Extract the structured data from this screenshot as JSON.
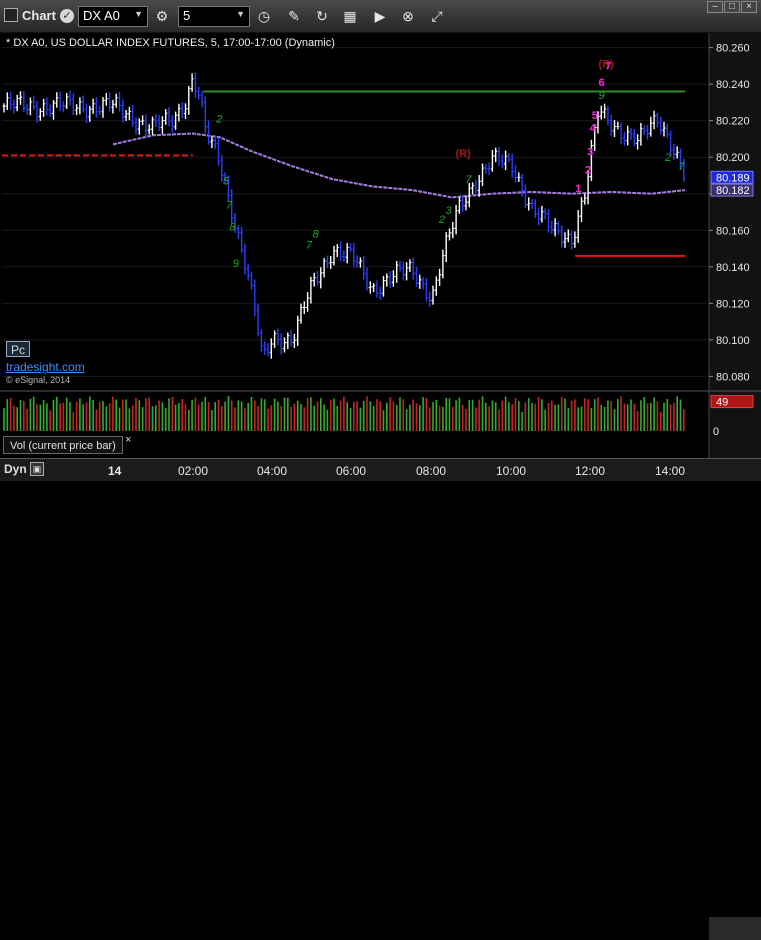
{
  "toolbar": {
    "window_title": "Chart",
    "symbol": "DX A0",
    "interval": "5",
    "badge": "✓"
  },
  "legend": {
    "description": "* DX A0, US DOLLAR INDEX FUTURES, 5, 17:00-17:00 (Dynamic)"
  },
  "overlay": {
    "pc_label": "Pc",
    "brand": "tradesight.com",
    "copyright": "© eSignal, 2014"
  },
  "volume_panel": {
    "label": "Vol (current price bar)",
    "close_glyph": "×"
  },
  "bottom": {
    "mode": "Dyn",
    "time_ticks": [
      "14",
      "02:00",
      "04:00",
      "06:00",
      "08:00",
      "10:00",
      "12:00",
      "14:00"
    ]
  },
  "colors": {
    "background": "#000000",
    "up_bar": "#ffffff",
    "down_bar": "#2a3cff",
    "moving_average": "#a47ee0",
    "support_line": "#e01818",
    "resistance_line": "#2e8b2e",
    "setup_count": "#1fa81f",
    "sequential_count": "#ff22dd",
    "recycle_marker": "#a01515",
    "volume_bar_up": "#2fae2f",
    "volume_bar_down": "#cc2222"
  },
  "chart_data": [
    {
      "type": "candlestick",
      "title": "",
      "y_axis_ticks": [
        80.26,
        80.24,
        80.22,
        80.2,
        80.18,
        80.16,
        80.14,
        80.12,
        80.1,
        80.08
      ],
      "y_axis_tick_labels": [
        "80.260",
        "80.240",
        "80.220",
        "80.200",
        "",
        "80.160",
        "80.140",
        "80.120",
        "80.100",
        "80.080"
      ],
      "ylim": [
        80.072,
        80.268
      ],
      "y_axis_side": "right",
      "x_axis": [
        "14",
        "02:00",
        "04:00",
        "06:00",
        "08:00",
        "10:00",
        "12:00",
        "14:00"
      ],
      "price_markers": [
        {
          "label": "80.189",
          "value": 80.189,
          "style": "price"
        },
        {
          "label": "80.182",
          "value": 80.182,
          "style": "average"
        }
      ],
      "price_series": [
        {
          "time": "00:00",
          "price": 80.228
        },
        {
          "time": "00:30",
          "price": 80.222
        },
        {
          "time": "01:00",
          "price": 80.216
        },
        {
          "time": "01:30",
          "price": 80.22
        },
        {
          "time": "01:50",
          "price": 80.232
        },
        {
          "time": "02:00",
          "price": 80.244
        },
        {
          "time": "02:10",
          "price": 80.233
        },
        {
          "time": "02:20",
          "price": 80.212
        },
        {
          "time": "02:40",
          "price": 80.198
        },
        {
          "time": "03:00",
          "price": 80.17
        },
        {
          "time": "03:20",
          "price": 80.14
        },
        {
          "time": "03:35",
          "price": 80.112
        },
        {
          "time": "03:45",
          "price": 80.088
        },
        {
          "time": "04:00",
          "price": 80.102
        },
        {
          "time": "04:30",
          "price": 80.1
        },
        {
          "time": "05:00",
          "price": 80.13
        },
        {
          "time": "05:30",
          "price": 80.15
        },
        {
          "time": "06:00",
          "price": 80.145
        },
        {
          "time": "06:30",
          "price": 80.128
        },
        {
          "time": "07:00",
          "price": 80.135
        },
        {
          "time": "07:30",
          "price": 80.138
        },
        {
          "time": "08:00",
          "price": 80.124
        },
        {
          "time": "08:20",
          "price": 80.15
        },
        {
          "time": "08:40",
          "price": 80.172
        },
        {
          "time": "09:00",
          "price": 80.185
        },
        {
          "time": "09:30",
          "price": 80.198
        },
        {
          "time": "10:00",
          "price": 80.196
        },
        {
          "time": "10:30",
          "price": 80.172
        },
        {
          "time": "11:00",
          "price": 80.16
        },
        {
          "time": "11:30",
          "price": 80.156
        },
        {
          "time": "11:50",
          "price": 80.18
        },
        {
          "time": "12:10",
          "price": 80.225
        },
        {
          "time": "12:40",
          "price": 80.216
        },
        {
          "time": "13:10",
          "price": 80.208
        },
        {
          "time": "13:40",
          "price": 80.222
        },
        {
          "time": "14:00",
          "price": 80.208
        },
        {
          "time": "14:20",
          "price": 80.189
        }
      ],
      "moving_average": [
        {
          "time": "00:00",
          "value": 80.207
        },
        {
          "time": "01:00",
          "value": 80.212
        },
        {
          "time": "02:00",
          "value": 80.213
        },
        {
          "time": "02:40",
          "value": 80.211
        },
        {
          "time": "03:30",
          "value": 80.203
        },
        {
          "time": "04:30",
          "value": 80.195
        },
        {
          "time": "05:30",
          "value": 80.188
        },
        {
          "time": "06:30",
          "value": 80.184
        },
        {
          "time": "07:30",
          "value": 80.182
        },
        {
          "time": "08:30",
          "value": 80.178
        },
        {
          "time": "09:30",
          "value": 80.18
        },
        {
          "time": "10:30",
          "value": 80.181
        },
        {
          "time": "11:30",
          "value": 80.18
        },
        {
          "time": "12:30",
          "value": 80.181
        },
        {
          "time": "13:30",
          "value": 80.18
        },
        {
          "time": "14:20",
          "value": 80.182
        }
      ],
      "horizontal_levels": [
        {
          "kind": "resistance",
          "value": 80.236,
          "from": "02:15",
          "to": "14:20"
        },
        {
          "kind": "support",
          "value": 80.201,
          "from": "00:00",
          "to": "02:00",
          "dashed": true
        },
        {
          "kind": "support",
          "value": 80.146,
          "from": "11:35",
          "to": "14:20"
        }
      ],
      "annotations": [
        {
          "text": "(R)",
          "time": "12:10",
          "price": 80.249,
          "kind": "recycle"
        },
        {
          "text": "7",
          "time": "12:20",
          "price": 80.248,
          "kind": "sequential"
        },
        {
          "text": "6",
          "time": "12:10",
          "price": 80.239,
          "kind": "sequential"
        },
        {
          "text": "5",
          "time": "12:00",
          "price": 80.221,
          "kind": "sequential"
        },
        {
          "text": "4",
          "time": "11:57",
          "price": 80.214,
          "kind": "sequential"
        },
        {
          "text": "3",
          "time": "11:53",
          "price": 80.201,
          "kind": "sequential"
        },
        {
          "text": "2",
          "time": "11:50",
          "price": 80.191,
          "kind": "sequential"
        },
        {
          "text": "1",
          "time": "11:35",
          "price": 80.181,
          "kind": "sequential"
        },
        {
          "text": "(R)",
          "time": "08:35",
          "price": 80.2,
          "kind": "recycle"
        },
        {
          "text": "2",
          "time": "02:35",
          "price": 80.219,
          "kind": "setup"
        },
        {
          "text": "5",
          "time": "02:45",
          "price": 80.185,
          "kind": "setup"
        },
        {
          "text": "7",
          "time": "02:50",
          "price": 80.172,
          "kind": "setup"
        },
        {
          "text": "8",
          "time": "02:55",
          "price": 80.16,
          "kind": "setup"
        },
        {
          "text": "9",
          "time": "03:00",
          "price": 80.14,
          "kind": "setup"
        },
        {
          "text": "7",
          "time": "04:50",
          "price": 80.15,
          "kind": "setup"
        },
        {
          "text": "8",
          "time": "05:00",
          "price": 80.156,
          "kind": "setup"
        },
        {
          "text": "2",
          "time": "08:10",
          "price": 80.164,
          "kind": "setup"
        },
        {
          "text": "3",
          "time": "08:20",
          "price": 80.169,
          "kind": "setup"
        },
        {
          "text": "7",
          "time": "08:50",
          "price": 80.186,
          "kind": "setup"
        },
        {
          "text": "9",
          "time": "12:10",
          "price": 80.232,
          "kind": "setup"
        },
        {
          "text": "2",
          "time": "13:50",
          "price": 80.198,
          "kind": "setup"
        },
        {
          "text": "7",
          "time": "14:10",
          "price": 80.193,
          "kind": "setup"
        }
      ]
    },
    {
      "type": "bar",
      "title": "Vol (current price bar)",
      "y_axis_ticks": [
        0
      ],
      "y_axis_tick_labels": [
        "0"
      ],
      "current_value_label": "49",
      "current_value": 49,
      "ylim": [
        0,
        60
      ]
    }
  ]
}
